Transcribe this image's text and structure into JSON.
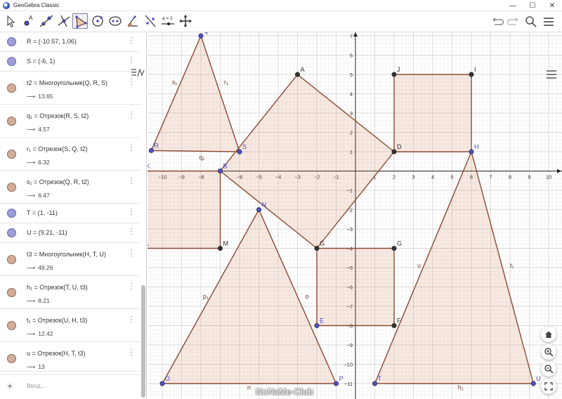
{
  "window": {
    "title": "GeoGebra Classic",
    "minimize": "—",
    "maximize": "☐",
    "close": "✕"
  },
  "toolbar": {
    "tools": [
      {
        "name": "move-tool-icon",
        "selected": false
      },
      {
        "name": "point-tool-icon",
        "selected": false
      },
      {
        "name": "line-tool-icon",
        "selected": false
      },
      {
        "name": "perpendicular-tool-icon",
        "selected": false
      },
      {
        "name": "polygon-tool-icon",
        "selected": true
      },
      {
        "name": "circle-tool-icon",
        "selected": false
      },
      {
        "name": "ellipse-tool-icon",
        "selected": false
      },
      {
        "name": "angle-tool-icon",
        "selected": false
      },
      {
        "name": "reflect-tool-icon",
        "selected": false
      },
      {
        "name": "slider-tool-icon",
        "slider_label": "a = 2",
        "selected": false
      },
      {
        "name": "move-graphics-tool-icon",
        "selected": false
      }
    ],
    "right": [
      "undo-icon",
      "redo-icon",
      "search-icon",
      "menu-icon"
    ]
  },
  "algebra": {
    "rows": [
      {
        "kind": "pt",
        "expr": "R = (-10.57, 1.06)"
      },
      {
        "kind": "pt",
        "expr": "S = (-6, 1)"
      },
      {
        "kind": "fig",
        "expr": "t2 = Многоугольник(Q, R, S)",
        "value": "13.65"
      },
      {
        "kind": "fig",
        "expr": "q₁ = Отрезок(R, S, t2)",
        "value": "4.57"
      },
      {
        "kind": "fig",
        "expr": "r₁ = Отрезок(S, Q, t2)",
        "value": "6.32"
      },
      {
        "kind": "fig",
        "expr": "s₁ = Отрезок(Q, R, t2)",
        "value": "6.47"
      },
      {
        "kind": "pt",
        "expr": "T = (1, -11)"
      },
      {
        "kind": "pt",
        "expr": "U = (9.21, -11)"
      },
      {
        "kind": "fig",
        "expr": "t3 = Многоугольник(H, T, U)",
        "value": "49.26"
      },
      {
        "kind": "fig",
        "expr": "h₁ = Отрезок(T, U, t3)",
        "value": "8.21"
      },
      {
        "kind": "fig",
        "expr": "t₁ = Отрезок(U, H, t3)",
        "value": "12.42"
      },
      {
        "kind": "fig",
        "expr": "u = Отрезок(H, T, t3)",
        "value": "13"
      }
    ],
    "value_arrow": "⟶",
    "input_placeholder": "Ввод...",
    "input_plus": "+"
  },
  "graphics": {
    "colors": {
      "fill": "#cc6633",
      "edge": "#8a4a32",
      "point_blue": "#4d4dcc",
      "point_dark": "#333333"
    },
    "axis": {
      "xmin": -10,
      "xmax": 10,
      "ymin": -11,
      "ymax": 7
    },
    "points": [
      {
        "name": "Q",
        "x": -8,
        "y": 7,
        "c": "blue"
      },
      {
        "name": "R",
        "x": -10.57,
        "y": 1.06,
        "c": "blue"
      },
      {
        "name": "S",
        "x": -6,
        "y": 1,
        "c": "blue"
      },
      {
        "name": "A",
        "x": -3,
        "y": 5,
        "c": "dark"
      },
      {
        "name": "B",
        "x": -7,
        "y": 0,
        "c": "blue"
      },
      {
        "name": "J",
        "x": 2,
        "y": 5,
        "c": "dark"
      },
      {
        "name": "I",
        "x": 6,
        "y": 5,
        "c": "dark"
      },
      {
        "name": "D",
        "x": 2,
        "y": 1,
        "c": "dark"
      },
      {
        "name": "H",
        "x": 6,
        "y": 1,
        "c": "blue"
      },
      {
        "name": "K",
        "x": -11,
        "y": 0,
        "c": "blue"
      },
      {
        "name": "L",
        "x": -11,
        "y": -4,
        "c": "dark"
      },
      {
        "name": "M",
        "x": -7,
        "y": -4,
        "c": "dark"
      },
      {
        "name": "N",
        "x": -5,
        "y": -2,
        "c": "blue"
      },
      {
        "name": "G",
        "x": -2,
        "y": -4,
        "c": "dark"
      },
      {
        "name": "G",
        "x": 2,
        "y": -4,
        "c": "dark"
      },
      {
        "name": "E",
        "x": -2,
        "y": -8,
        "c": "blue"
      },
      {
        "name": "F",
        "x": 2,
        "y": -8,
        "c": "dark"
      },
      {
        "name": "O",
        "x": -10,
        "y": -11,
        "c": "blue"
      },
      {
        "name": "P",
        "x": -1,
        "y": -11,
        "c": "blue"
      },
      {
        "name": "T",
        "x": 1,
        "y": -11,
        "c": "blue"
      },
      {
        "name": "U",
        "x": 9.21,
        "y": -11,
        "c": "blue"
      }
    ],
    "polygons": [
      {
        "name": "t2",
        "pts": [
          [
            -8,
            7
          ],
          [
            -10.57,
            1.06
          ],
          [
            -6,
            1
          ]
        ]
      },
      {
        "name": "quad-ABGD",
        "pts": [
          [
            -3,
            5
          ],
          [
            -7,
            0
          ],
          [
            -2,
            -4
          ],
          [
            2,
            1
          ]
        ]
      },
      {
        "name": "square-JIHD",
        "pts": [
          [
            2,
            5
          ],
          [
            6,
            5
          ],
          [
            6,
            1
          ],
          [
            2,
            1
          ]
        ]
      },
      {
        "name": "square-KBML",
        "pts": [
          [
            -11,
            0
          ],
          [
            -7,
            0
          ],
          [
            -7,
            -4
          ],
          [
            -11,
            -4
          ]
        ]
      },
      {
        "name": "square-GGFE",
        "pts": [
          [
            -2,
            -4
          ],
          [
            2,
            -4
          ],
          [
            2,
            -8
          ],
          [
            -2,
            -8
          ]
        ]
      },
      {
        "name": "triangle-NOP",
        "pts": [
          [
            -5,
            -2
          ],
          [
            -10,
            -11
          ],
          [
            -1,
            -11
          ]
        ]
      },
      {
        "name": "t3",
        "pts": [
          [
            6,
            1
          ],
          [
            1,
            -11
          ],
          [
            9.21,
            -11
          ]
        ]
      }
    ],
    "segment_labels": [
      {
        "text": "s₁",
        "x": -9.5,
        "y": 4.5
      },
      {
        "text": "r₁",
        "x": -6.8,
        "y": 4.5
      },
      {
        "text": "q₁",
        "x": -8.1,
        "y": 0.6
      },
      {
        "text": "p₁",
        "x": -7.9,
        "y": -6.6
      },
      {
        "text": "o",
        "x": -2.6,
        "y": -6.6
      },
      {
        "text": "n",
        "x": -5.6,
        "y": -11.3
      },
      {
        "text": "u",
        "x": 3.2,
        "y": -5.0
      },
      {
        "text": "t₁",
        "x": 8.0,
        "y": -5.0
      },
      {
        "text": "h₁",
        "x": 5.3,
        "y": -11.3
      }
    ],
    "nav_buttons": [
      "home-icon",
      "zoom-in-icon",
      "zoom-out-icon",
      "fullscreen-icon"
    ]
  },
  "watermark": "NoNaMe-Club"
}
